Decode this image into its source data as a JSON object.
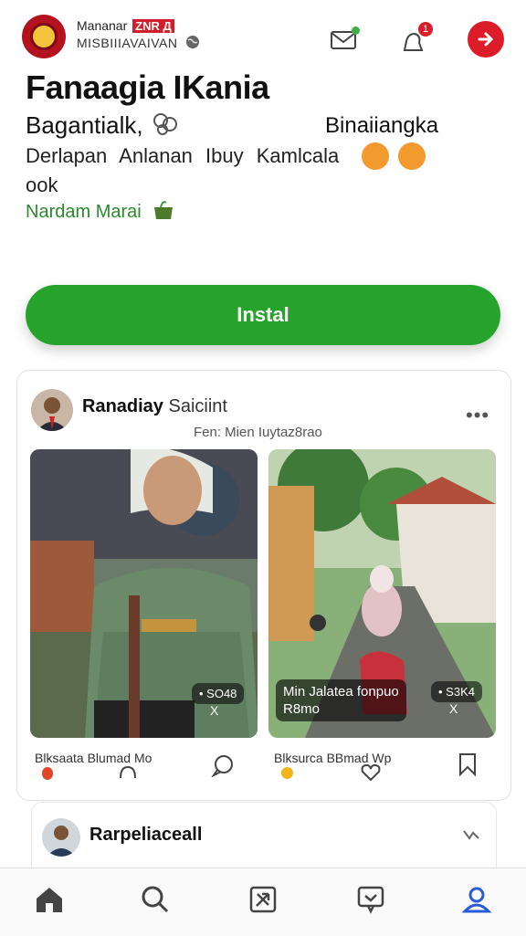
{
  "header": {
    "brand_line1": "Mananar",
    "brand_tag": "ZNR Д",
    "brand_line2": "MISBIIIAVAIVAN",
    "notification_count": "1"
  },
  "hero": {
    "title": "Fanaagia IKania",
    "line1_left": "Bagantialk,",
    "line1_right": "Binaiiangka",
    "line2": "Derlapan Anlanan Ibuy Kamlcala",
    "line2_cont": "ook",
    "green_label": "Nardam Marai"
  },
  "install_label": "Instal",
  "post": {
    "author": "Ranadiay",
    "author_suffix": "Saiciint",
    "subtitle": "Fen: Mien Iuytaz8rao",
    "more_label": "•••",
    "left_image": {
      "badge": "• SO48",
      "badge2": "X"
    },
    "right_image": {
      "caption_line1": "Min Jalatea fonpuo",
      "caption_line2": "R8mo",
      "badge": "• S3K4",
      "badge2": "X"
    },
    "left_action_label": "Blksaata Blumad Mo",
    "right_action_label": "Blksurca BBmad Wp"
  },
  "post2": {
    "author": "Rarpeliaceall"
  },
  "tabs": [
    "home-icon",
    "search-icon",
    "create-icon",
    "messages-icon",
    "profile-icon"
  ],
  "colors": {
    "accent_green": "#25a32b",
    "brand_red": "#dd1c2a",
    "profile_tab_blue": "#2a5bd7"
  }
}
